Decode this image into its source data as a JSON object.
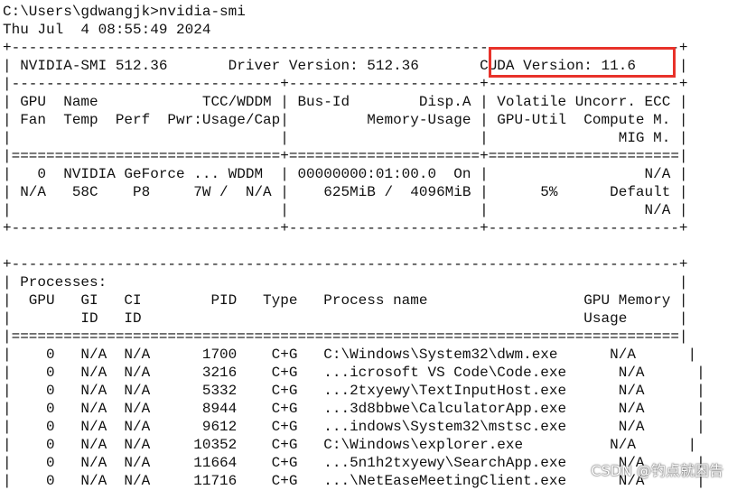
{
  "terminal": {
    "lines": [
      "C:\\Users\\gdwangjk>nvidia-smi",
      "Thu Jul  4 08:55:49 2024",
      "+-----------------------------------------------------------------------------+",
      "| NVIDIA-SMI 512.36       Driver Version: 512.36       CUDA Version: 11.6     |",
      "|-------------------------------+----------------------+----------------------+",
      "| GPU  Name            TCC/WDDM | Bus-Id        Disp.A | Volatile Uncorr. ECC |",
      "| Fan  Temp  Perf  Pwr:Usage/Cap|         Memory-Usage | GPU-Util  Compute M. |",
      "|                               |                      |               MIG M. |",
      "|===============================+======================+======================|",
      "|   0  NVIDIA GeForce ... WDDM  | 00000000:01:00.0  On |                  N/A |",
      "| N/A   58C    P8     7W /  N/A |    625MiB /  4096MiB |      5%      Default |",
      "|                               |                      |                  N/A |",
      "+-------------------------------+----------------------+----------------------+",
      "",
      "+-----------------------------------------------------------------------------+",
      "| Processes:                                                                  |",
      "|  GPU   GI   CI        PID   Type   Process name                  GPU Memory |",
      "|        ID   ID                                                   Usage      |",
      "|=============================================================================|",
      "|    0   N/A  N/A      1700    C+G   C:\\Windows\\System32\\dwm.exe      N/A      |",
      "|    0   N/A  N/A      3216    C+G   ...icrosoft VS Code\\Code.exe      N/A      |",
      "|    0   N/A  N/A      5332    C+G   ...2txyewy\\TextInputHost.exe      N/A      |",
      "|    0   N/A  N/A      8944    C+G   ...3d8bbwe\\CalculatorApp.exe      N/A      |",
      "|    0   N/A  N/A      9612    C+G   ...indows\\System32\\mstsc.exe      N/A      |",
      "|    0   N/A  N/A     10352    C+G   C:\\Windows\\explorer.exe          N/A      |",
      "|    0   N/A  N/A     11664    C+G   ...5n1h2txyewy\\SearchApp.exe      N/A      |",
      "|    0   N/A  N/A     11716    C+G   ...\\NetEaseMeetingClient.exe      N/A      |"
    ]
  },
  "annotation": {
    "highlight_color": "#e8322a"
  },
  "watermark": {
    "text": "CSDN @钓点就困告"
  }
}
